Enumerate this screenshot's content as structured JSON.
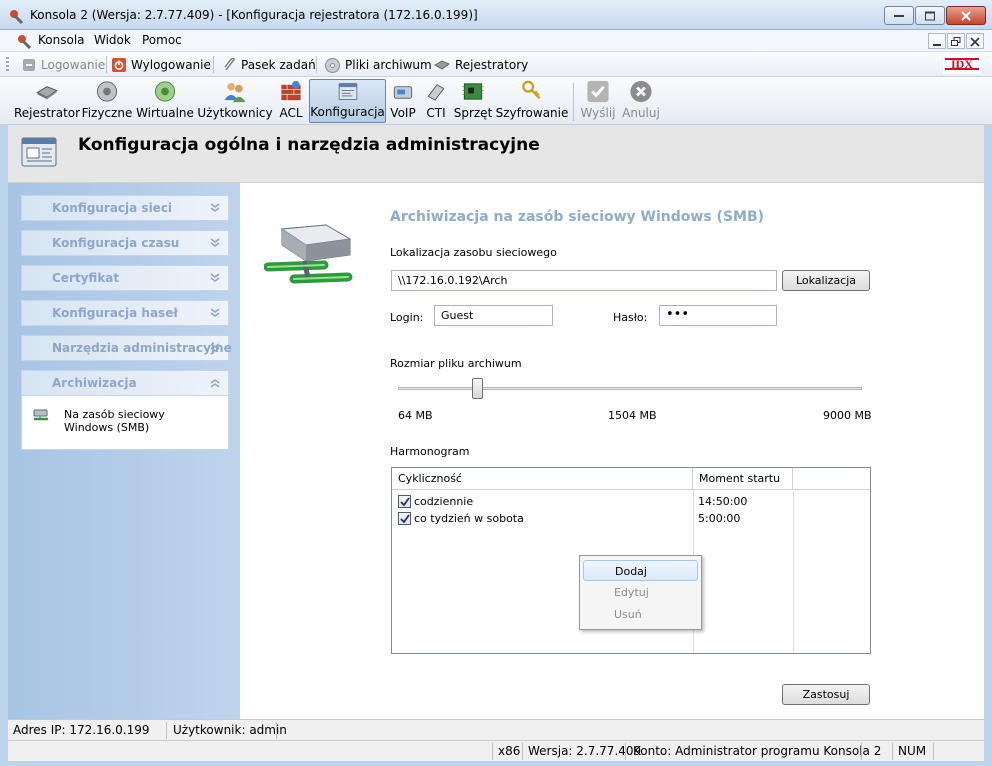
{
  "window": {
    "title": "Konsola 2 (Wersja:  2.7.77.409) - [Konfiguracja rejestratora (172.16.0.199)]"
  },
  "menu": {
    "items": [
      "Konsola",
      "Widok",
      "Pomoc"
    ]
  },
  "toolbar1": {
    "login": "Logowanie",
    "logout": "Wylogowanie",
    "taskbar": "Pasek zadań",
    "archive_files": "Pliki archiwum",
    "recorders": "Rejestratory",
    "logo": "IDX"
  },
  "toolbar2": {
    "items": [
      "Rejestrator",
      "Fizyczne",
      "Wirtualne",
      "Użytkownicy",
      "ACL",
      "Konfiguracja",
      "VoIP",
      "CTI",
      "Sprzęt",
      "Szyfrowanie",
      "Wyślij",
      "Anuluj"
    ]
  },
  "header": {
    "title": "Konfiguracja ogólna i narzędzia administracyjne"
  },
  "sidebar": {
    "panels": [
      "Konfiguracja sieci",
      "Konfiguracja czasu",
      "Certyfikat",
      "Konfiguracja haseł",
      "Narzędzia administracyjne",
      "Archiwizacja"
    ],
    "archive_item": "Na zasób sieciowy Windows (SMB)"
  },
  "form": {
    "section_title": "Archiwizacja na zasób sieciowy Windows (SMB)",
    "location_label": "Lokalizacja zasobu sieciowego",
    "location_value": "\\\\172.16.0.192\\Arch",
    "location_button": "Lokalizacja",
    "login_label": "Login:",
    "login_value": "Guest",
    "password_label": "Hasło:",
    "password_value": "•••",
    "size_label": "Rozmiar pliku archiwum",
    "size_min": "64 MB",
    "size_mid": "1504 MB",
    "size_max": "9000 MB",
    "size_level_fraction": 0.18,
    "schedule_label": "Harmonogram",
    "apply_button": "Zastosuj"
  },
  "schedule": {
    "columns": [
      "Cykliczność",
      "Moment startu"
    ],
    "rows": [
      {
        "checked": true,
        "cycle": "codziennie",
        "start": "14:50:00"
      },
      {
        "checked": true,
        "cycle": "co tydzień w sobota",
        "start": "5:00:00"
      }
    ]
  },
  "context_menu": {
    "items": [
      "Dodaj",
      "Edytuj",
      "Usuń"
    ]
  },
  "status": {
    "ip": "Adres IP: 172.16.0.199",
    "user": "Użytkownik: admin",
    "arch": "x86",
    "version": "Wersja: 2.7.77.409",
    "account": "Konto: Administrator programu Konsola 2",
    "num": "NUM"
  },
  "colors": {
    "sidebar_bg": "#bcd3ea",
    "section_title": "#8eaccd",
    "accent_red": "#c7442b"
  }
}
